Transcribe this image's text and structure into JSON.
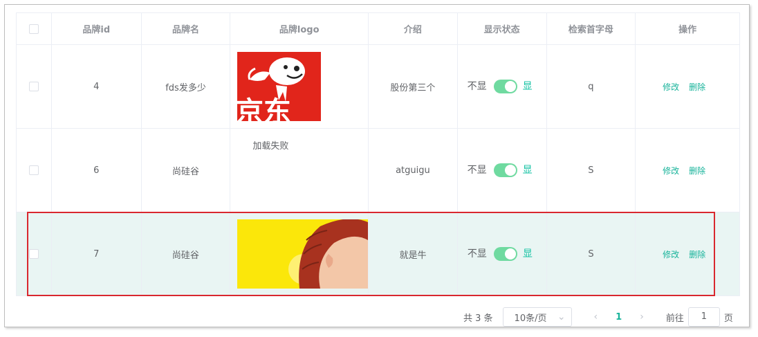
{
  "columns": [
    "品牌id",
    "品牌名",
    "品牌logo",
    "介绍",
    "显示状态",
    "检索首字母",
    "操作"
  ],
  "rows": [
    {
      "id": "4",
      "name": "fds发多少",
      "logo": "jd",
      "intro": "股份第三个",
      "status_off": "不显",
      "status_on": "显",
      "first_letter": "q",
      "edit": "修改",
      "delete": "删除"
    },
    {
      "id": "6",
      "name": "尚硅谷",
      "logo": "failed",
      "logo_fail_text": "加载失败",
      "intro": "atguigu",
      "status_off": "不显",
      "status_on": "显",
      "first_letter": "S",
      "edit": "修改",
      "delete": "删除"
    },
    {
      "id": "7",
      "name": "尚硅谷",
      "logo": "illustration",
      "intro": "就是牛",
      "status_off": "不显",
      "status_on": "显",
      "first_letter": "S",
      "edit": "修改",
      "delete": "删除"
    }
  ],
  "jd_logo_text": "京东",
  "pagination": {
    "total": "共 3 条",
    "page_size": "10条/页",
    "current_page": "1",
    "goto_label": "前往",
    "goto_value": "1",
    "goto_suffix": "页"
  },
  "colors": {
    "accent": "#17b39a",
    "toggle_on": "#6fdaa0",
    "highlight": "#d9272e",
    "row_hover": "#e9f5f3"
  }
}
